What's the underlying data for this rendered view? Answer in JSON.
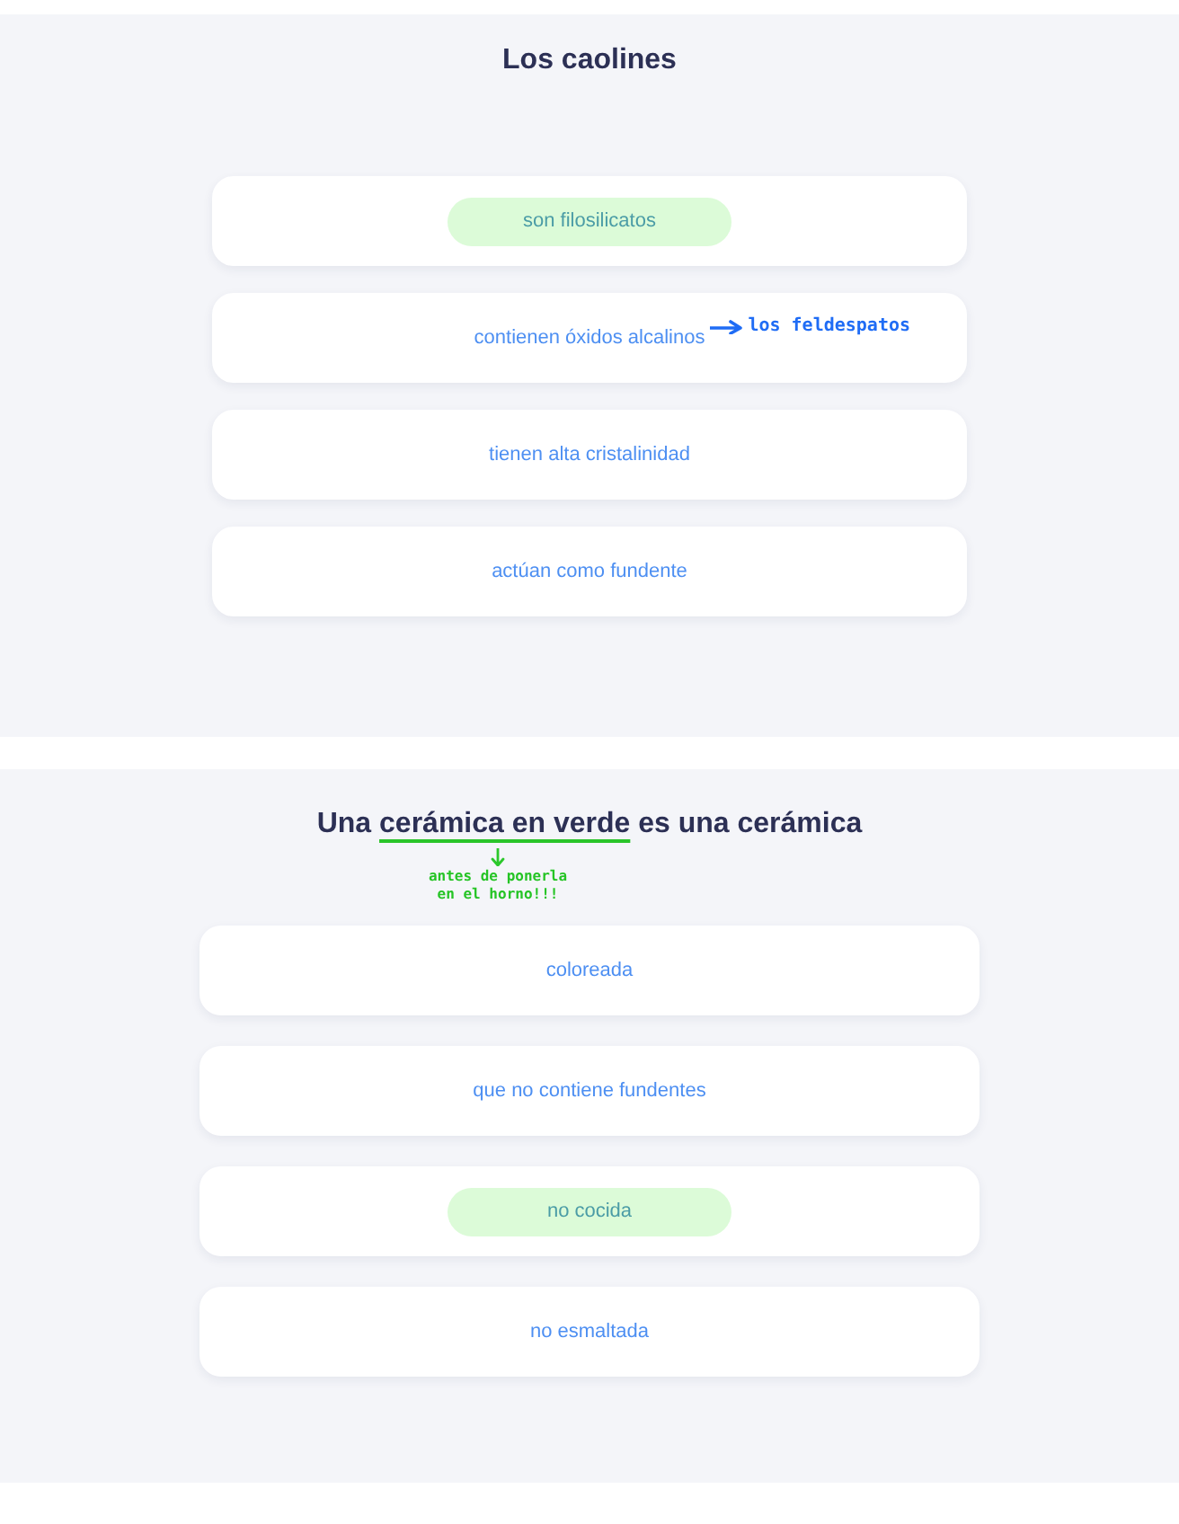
{
  "questions": [
    {
      "title": [
        {
          "text": "Los caolines",
          "marked": false
        }
      ],
      "options": [
        {
          "text": "son filosilicatos",
          "selected": true
        },
        {
          "text": "contienen óxidos alcalinos",
          "selected": false,
          "note": "los feldespatos"
        },
        {
          "text": "tienen alta cristalinidad",
          "selected": false
        },
        {
          "text": "actúan como fundente",
          "selected": false
        }
      ]
    },
    {
      "title": [
        {
          "text": "Una ",
          "marked": false
        },
        {
          "text": "cerámica en verde",
          "marked": true
        },
        {
          "text": " es una cerámica",
          "marked": false
        }
      ],
      "note": "antes de ponerla en el horno!!!",
      "options": [
        {
          "text": "coloreada",
          "selected": false
        },
        {
          "text": "que no contiene fundentes",
          "selected": false
        },
        {
          "text": "no cocida",
          "selected": true
        },
        {
          "text": "no esmaltada",
          "selected": false
        }
      ]
    }
  ]
}
